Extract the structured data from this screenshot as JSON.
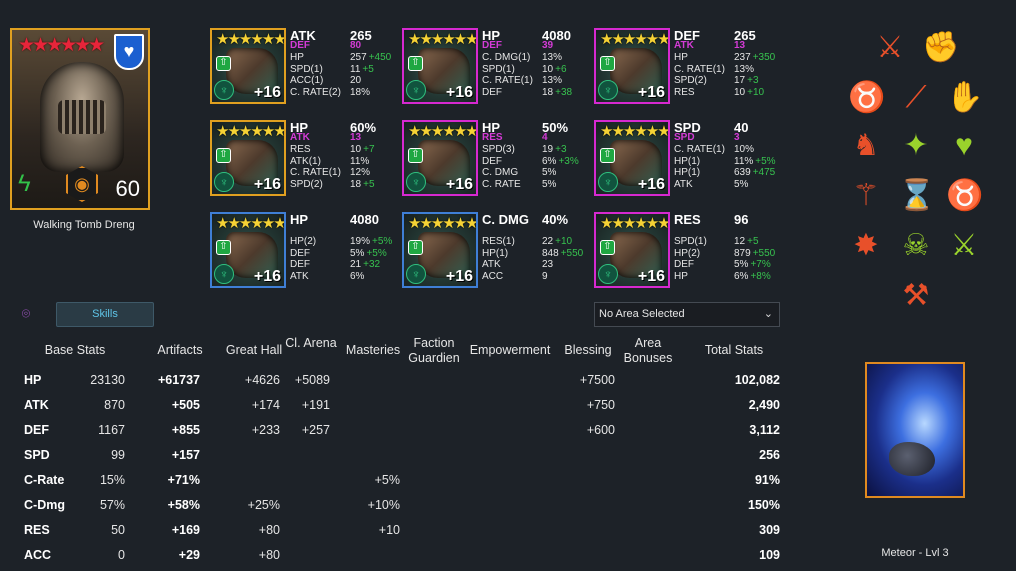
{
  "hero": {
    "name": "Walking Tomb Dreng",
    "level": "60",
    "stars": "★★★★★★",
    "badge_icon": "heart-icon",
    "affinity_icon": "force-lightning-icon",
    "faction_icon": "faction-icon"
  },
  "gear": [
    {
      "stars": "★★★★★★",
      "main": "ATK",
      "main_value": "265",
      "sub": "DEF",
      "sub_value": "80",
      "level": "+16",
      "lines": [
        {
          "n": "HP",
          "v": "257",
          "g": "+450"
        },
        {
          "n": "SPD(1)",
          "v": "11",
          "g": "+5"
        },
        {
          "n": "ACC(1)",
          "v": "20",
          "g": ""
        },
        {
          "n": "C. RATE(2)",
          "v": "18%",
          "g": ""
        }
      ]
    },
    {
      "stars": "★★★★★★",
      "main": "HP",
      "main_value": "4080",
      "sub": "DEF",
      "sub_value": "39",
      "level": "+16",
      "lines": [
        {
          "n": "C. DMG(1)",
          "v": "13%",
          "g": ""
        },
        {
          "n": "SPD(1)",
          "v": "10",
          "g": "+6"
        },
        {
          "n": "C. RATE(1)",
          "v": "13%",
          "g": ""
        },
        {
          "n": "DEF",
          "v": "18",
          "g": "+38"
        }
      ]
    },
    {
      "stars": "★★★★★★",
      "main": "DEF",
      "main_value": "265",
      "sub": "ATK",
      "sub_value": "13",
      "level": "+16",
      "lines": [
        {
          "n": "HP",
          "v": "237",
          "g": "+350"
        },
        {
          "n": "C. RATE(1)",
          "v": "13%",
          "g": ""
        },
        {
          "n": "SPD(2)",
          "v": "17",
          "g": "+3"
        },
        {
          "n": "RES",
          "v": "10",
          "g": "+10"
        }
      ]
    },
    {
      "stars": "★★★★★★",
      "main": "HP",
      "main_value": "60%",
      "sub": "ATK",
      "sub_value": "13",
      "level": "+16",
      "lines": [
        {
          "n": "RES",
          "v": "10",
          "g": "+7"
        },
        {
          "n": "ATK(1)",
          "v": "11%",
          "g": ""
        },
        {
          "n": "C. RATE(1)",
          "v": "12%",
          "g": ""
        },
        {
          "n": "SPD(2)",
          "v": "18",
          "g": "+5"
        }
      ]
    },
    {
      "stars": "★★★★★★",
      "main": "HP",
      "main_value": "50%",
      "sub": "RES",
      "sub_value": "4",
      "level": "+16",
      "lines": [
        {
          "n": "SPD(3)",
          "v": "19",
          "g": "+3"
        },
        {
          "n": "DEF",
          "v": "6%",
          "g": "+3%"
        },
        {
          "n": "C. DMG",
          "v": "5%",
          "g": ""
        },
        {
          "n": "C. RATE",
          "v": "5%",
          "g": ""
        }
      ]
    },
    {
      "stars": "★★★★★★",
      "main": "SPD",
      "main_value": "40",
      "sub": "SPD",
      "sub_value": "3",
      "level": "+16",
      "lines": [
        {
          "n": "C. RATE(1)",
          "v": "10%",
          "g": ""
        },
        {
          "n": "HP(1)",
          "v": "11%",
          "g": "+5%"
        },
        {
          "n": "HP(1)",
          "v": "639",
          "g": "+475"
        },
        {
          "n": "ATK",
          "v": "5%",
          "g": ""
        }
      ]
    },
    {
      "stars": "★★★★★★",
      "main": "HP",
      "main_value": "4080",
      "sub": "",
      "sub_value": "",
      "level": "+16",
      "lines": [
        {
          "n": "HP(2)",
          "v": "19%",
          "g": "+5%"
        },
        {
          "n": "DEF",
          "v": "5%",
          "g": "+5%"
        },
        {
          "n": "DEF",
          "v": "21",
          "g": "+32"
        },
        {
          "n": "ATK",
          "v": "6%",
          "g": ""
        }
      ]
    },
    {
      "stars": "★★★★★★",
      "main": "C. DMG",
      "main_value": "40%",
      "sub": "",
      "sub_value": "",
      "level": "+16",
      "lines": [
        {
          "n": "RES(1)",
          "v": "22",
          "g": "+10"
        },
        {
          "n": "HP(1)",
          "v": "848",
          "g": "+550"
        },
        {
          "n": "ATK",
          "v": "23",
          "g": ""
        },
        {
          "n": "ACC",
          "v": "9",
          "g": ""
        }
      ]
    },
    {
      "stars": "★★★★★★",
      "main": "RES",
      "main_value": "96",
      "sub": "",
      "sub_value": "",
      "level": "+16",
      "lines": [
        {
          "n": "SPD(1)",
          "v": "12",
          "g": "+5"
        },
        {
          "n": "HP(2)",
          "v": "879",
          "g": "+550"
        },
        {
          "n": "DEF",
          "v": "5%",
          "g": "+7%"
        },
        {
          "n": "HP",
          "v": "6%",
          "g": "+8%"
        }
      ]
    }
  ],
  "controls": {
    "skills_label": "Skills",
    "area_select": "No Area Selected",
    "screenshot_icon": "camera-icon"
  },
  "table": {
    "headers": [
      "Base Stats",
      "Artifacts",
      "Great Hall",
      "Cl. Arena",
      "Masteries",
      "Faction Guardien",
      "Empowerment",
      "Blessing",
      "Area Bonuses",
      "Total Stats"
    ],
    "rows": [
      {
        "stat": "HP",
        "base": "23130",
        "artifacts": "+61737",
        "great_hall": "+4626",
        "arena": "+5089",
        "masteries": "",
        "blessing": "+7500",
        "total": "102,082"
      },
      {
        "stat": "ATK",
        "base": "870",
        "artifacts": "+505",
        "great_hall": "+174",
        "arena": "+191",
        "masteries": "",
        "blessing": "+750",
        "total": "2,490"
      },
      {
        "stat": "DEF",
        "base": "1167",
        "artifacts": "+855",
        "great_hall": "+233",
        "arena": "+257",
        "masteries": "",
        "blessing": "+600",
        "total": "3,112"
      },
      {
        "stat": "SPD",
        "base": "99",
        "artifacts": "+157",
        "great_hall": "",
        "arena": "",
        "masteries": "",
        "blessing": "",
        "total": "256"
      },
      {
        "stat": "C-Rate",
        "base": "15%",
        "artifacts": "+71%",
        "great_hall": "",
        "arena": "",
        "masteries": "+5%",
        "blessing": "",
        "total": "91%"
      },
      {
        "stat": "C-Dmg",
        "base": "57%",
        "artifacts": "+58%",
        "great_hall": "+25%",
        "arena": "",
        "masteries": "+10%",
        "blessing": "",
        "total": "150%"
      },
      {
        "stat": "RES",
        "base": "50",
        "artifacts": "+169",
        "great_hall": "+80",
        "arena": "",
        "masteries": "+10",
        "blessing": "",
        "total": "309"
      },
      {
        "stat": "ACC",
        "base": "0",
        "artifacts": "+29",
        "great_hall": "+80",
        "arena": "",
        "masteries": "",
        "blessing": "",
        "total": "109"
      }
    ]
  },
  "blessing": {
    "name": "Meteor - Lvl 3"
  },
  "skill_icons": [
    {
      "name": "sword-slash-icon",
      "glyph": "⚔",
      "color": "#e8502a"
    },
    {
      "name": "raised-fist-icon",
      "glyph": "✊",
      "color": "#9ad32c"
    },
    {
      "name": "demon-icon",
      "glyph": "♉",
      "color": "#e8502a"
    },
    {
      "name": "triple-slash-icon",
      "glyph": "⟋",
      "color": "#e8502a"
    },
    {
      "name": "heart-fist-icon",
      "glyph": "✋",
      "color": "#9ad32c"
    },
    {
      "name": "horse-icon",
      "glyph": "♞",
      "color": "#e8502a"
    },
    {
      "name": "figure-icon",
      "glyph": "✦",
      "color": "#9ad32c"
    },
    {
      "name": "skull-heart-icon",
      "glyph": "♥",
      "color": "#9ad32c"
    },
    {
      "name": "dagger-down-icon",
      "glyph": "⚚",
      "color": "#e8502a"
    },
    {
      "name": "hourglass-skull-icon",
      "glyph": "⌛",
      "color": "#9ad32c"
    },
    {
      "name": "bull-icon",
      "glyph": "♉",
      "color": "#9ad32c"
    },
    {
      "name": "burst-icon",
      "glyph": "✸",
      "color": "#e8502a"
    },
    {
      "name": "skull-icon",
      "glyph": "☠",
      "color": "#9ad32c"
    },
    {
      "name": "swords-crossed-icon",
      "glyph": "⚔",
      "color": "#9ad32c"
    },
    {
      "name": "broken-sword-icon",
      "glyph": "⚒",
      "color": "#e8502a"
    }
  ]
}
